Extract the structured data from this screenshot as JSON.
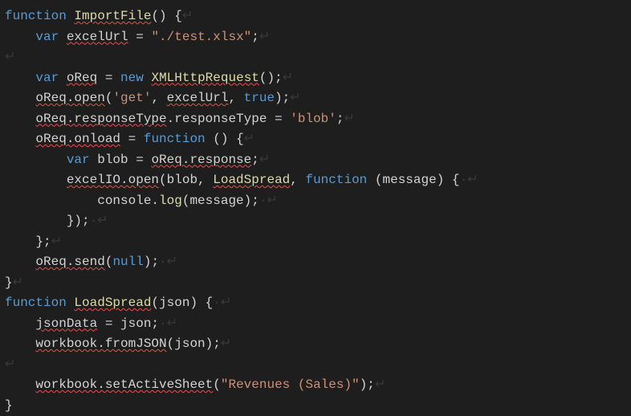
{
  "code": {
    "k_function": "function",
    "k_var": "var",
    "k_new": "new",
    "k_true": "true",
    "k_null": "null",
    "fn_ImportFile": "ImportFile",
    "fn_XMLHttpRequest": "XMLHttpRequest",
    "fn_open": "open",
    "fn_LoadSpread": "LoadSpread",
    "fn_log": "log",
    "fn_send": "send",
    "fn_fromJSON": "fromJSON",
    "fn_setActiveSheet": "setActiveSheet",
    "id_excelUrl": "excelUrl",
    "id_oReq": "oReq",
    "id_oReq_open": "oReq.open",
    "id_oReq_responseType": "oReq.responseType",
    "id_oReq_onload": "oReq.onload",
    "id_oReq_response": "oReq.response",
    "id_excelIO_open": "excelIO.open",
    "id_oReq_send": "oReq.send",
    "id_jsonData": "jsonData",
    "id_workbook_fromJSON": "workbook.fromJSON",
    "id_workbook_setActiveSheet": "workbook.setActiveSheet",
    "txt_responseType": ".responseType = ",
    "txt_onload_eq": " = ",
    "txt_blob_eq": " blob = ",
    "txt_console": "            console.",
    "txt_message": "(message);",
    "txt_json_param": "(json) {",
    "txt_json_eq": " = json;",
    "txt_json_arg": "(json);",
    "str_path": "\"./test.xlsx\"",
    "str_get": "'get'",
    "str_blob": "'blob'",
    "str_sheet": "\"Revenues (Sales)\"",
    "ws_dot": "·",
    "ws_ret": "↵"
  }
}
